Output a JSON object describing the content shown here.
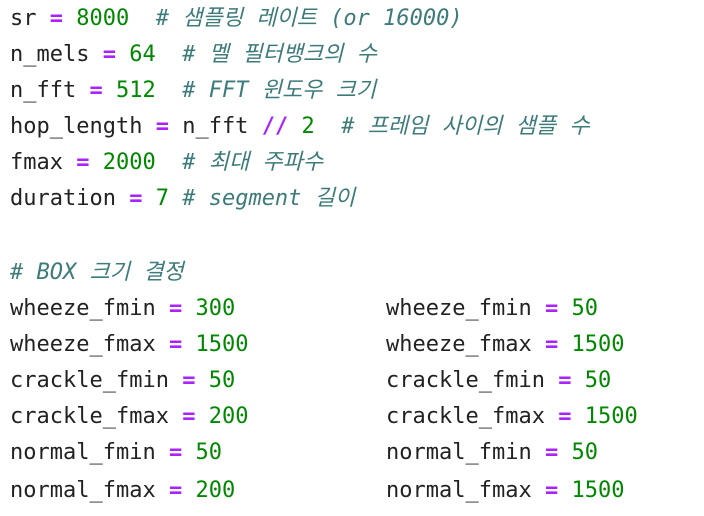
{
  "config_lines": [
    {
      "name": "sr",
      "op": "=",
      "value": "8000",
      "comment": "# 샘플링 레이트 (or 16000)"
    },
    {
      "name": "n_mels",
      "op": "=",
      "value": "64",
      "comment": "# 멜 필터뱅크의 수"
    },
    {
      "name": "n_fft",
      "op": "=",
      "value": "512",
      "comment": "# FFT 윈도우 크기"
    },
    {
      "name": "hop_length",
      "op": "=",
      "value_prefix": "n_fft",
      "value_op": "//",
      "value": "2",
      "comment": "# 프레임 사이의 샘플 수"
    },
    {
      "name": "fmax",
      "op": "=",
      "value": "2000",
      "comment": "# 최대 주파수"
    },
    {
      "name": "duration",
      "op": "=",
      "value": "7",
      "comment": "# segment 길이"
    }
  ],
  "box_section": {
    "comment": "# BOX 크기 결정",
    "left": [
      {
        "name": "wheeze_fmin",
        "op": "=",
        "value": "300"
      },
      {
        "name": "wheeze_fmax",
        "op": "=",
        "value": "1500"
      },
      {
        "name": "crackle_fmin",
        "op": "=",
        "value": "50"
      },
      {
        "name": "crackle_fmax",
        "op": "=",
        "value": "200"
      },
      {
        "name": "normal_fmin",
        "op": "=",
        "value": "50"
      },
      {
        "name": "normal_fmax",
        "op": "=",
        "value": "200"
      }
    ],
    "right": [
      {
        "name": "wheeze_fmin",
        "op": "=",
        "value": "50"
      },
      {
        "name": "wheeze_fmax",
        "op": "=",
        "value": "1500"
      },
      {
        "name": "crackle_fmin",
        "op": "=",
        "value": "50"
      },
      {
        "name": "crackle_fmax",
        "op": "=",
        "value": "1500"
      },
      {
        "name": "normal_fmin",
        "op": "=",
        "value": "50"
      },
      {
        "name": "normal_fmax",
        "op": "=",
        "value": "1500"
      }
    ]
  },
  "colors": {
    "operator": "#aa22ff",
    "number": "#008800",
    "comment": "#3d7b7b",
    "text": "#222222",
    "background": "#ffffff"
  }
}
